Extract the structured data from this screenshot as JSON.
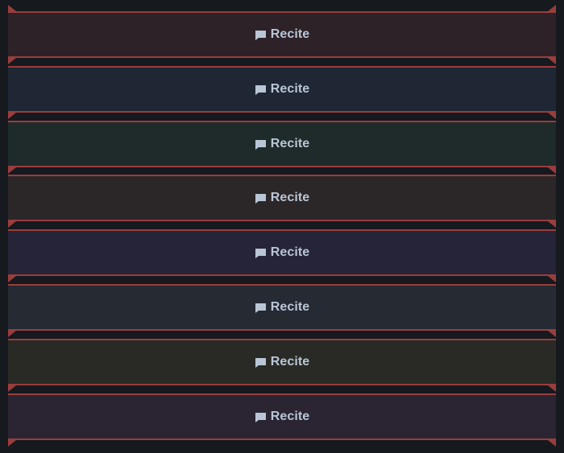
{
  "buttons": [
    {
      "label": "Recite",
      "icon": "speech-bubble-icon",
      "bg": "#2d2228"
    },
    {
      "label": "Recite",
      "icon": "speech-bubble-icon",
      "bg": "#1f2735"
    },
    {
      "label": "Recite",
      "icon": "speech-bubble-icon",
      "bg": "#1f2a2b"
    },
    {
      "label": "Recite",
      "icon": "speech-bubble-icon",
      "bg": "#2b2628"
    },
    {
      "label": "Recite",
      "icon": "speech-bubble-icon",
      "bg": "#262438"
    },
    {
      "label": "Recite",
      "icon": "speech-bubble-icon",
      "bg": "#252a33"
    },
    {
      "label": "Recite",
      "icon": "speech-bubble-icon",
      "bg": "#292a25"
    },
    {
      "label": "Recite",
      "icon": "speech-bubble-icon",
      "bg": "#2b2533"
    }
  ],
  "colors": {
    "page_bg": "#16191e",
    "accent": "#9a3d3d",
    "label": "#b9c6d6"
  }
}
